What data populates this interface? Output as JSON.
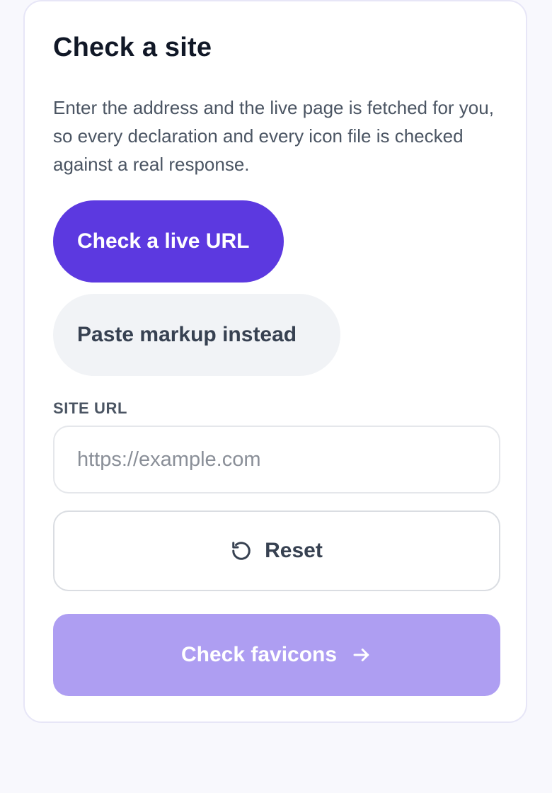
{
  "card": {
    "title": "Check a site",
    "description": "Enter the address and the live page is fetched for you, so every declaration and every icon file is checked against a real response."
  },
  "mode_toggle": {
    "live_label": "Check a live URL",
    "paste_label": "Paste markup instead",
    "selected": "live"
  },
  "url_field": {
    "label": "SITE URL",
    "placeholder": "https://example.com",
    "value": ""
  },
  "actions": {
    "reset_label": "Reset",
    "reset_icon": "rotate-ccw-icon",
    "submit_label": "Check favicons",
    "submit_icon": "arrow-right-icon",
    "submit_enabled": false
  },
  "colors": {
    "accent": "#5c39e0",
    "accent_disabled": "#ae9ef2",
    "page_bg": "#f8f8fd",
    "card_border": "#e7e6f7"
  }
}
